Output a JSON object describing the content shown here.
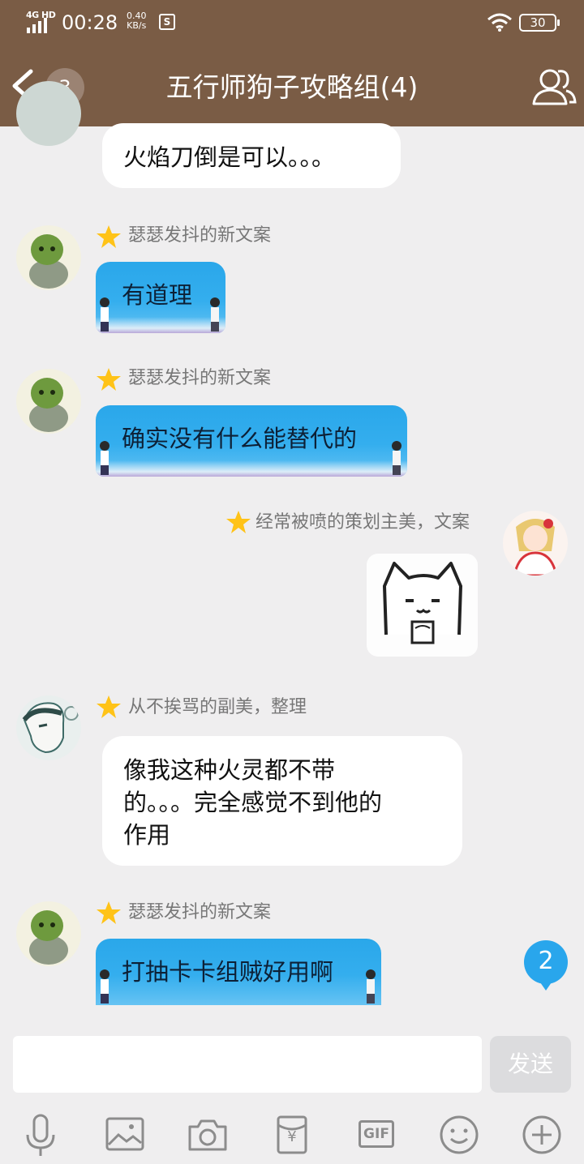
{
  "status_bar": {
    "network": "4G HD",
    "time": "00:28",
    "speed_value": "0.40",
    "speed_unit": "KB/s",
    "s_icon": "S",
    "battery": "30"
  },
  "header": {
    "unread_count": "3",
    "title": "五行师狗子攻略组(4)"
  },
  "messages": [
    {
      "text": "火焰刀倒是可以。。。"
    },
    {
      "sender": "瑟瑟发抖的新文案",
      "text": "有道理"
    },
    {
      "sender": "瑟瑟发抖的新文案",
      "text": "确实没有什么能替代的"
    },
    {
      "sender": "经常被喷的策划主美，文案"
    },
    {
      "sender": "从不挨骂的副美，整理",
      "lines": [
        "像我这种火灵都不带",
        "的。。。完全感觉不到他的",
        "作用"
      ]
    },
    {
      "sender": "瑟瑟发抖的新文案",
      "text": "打抽卡卡组贼好用啊"
    }
  ],
  "new_message_badge": "2",
  "input": {
    "value": "",
    "send_label": "发送"
  },
  "toolbar": {
    "items": [
      "mic-icon",
      "image-icon",
      "camera-icon",
      "red-packet-icon",
      "gif-icon",
      "emoji-icon",
      "plus-icon"
    ],
    "gif_label": "GIF",
    "red_packet_symbol": "¥"
  },
  "colors": {
    "header_bg": "#7a5c45",
    "chat_bg": "#efeeef",
    "bubble_blue": "#2aa7ea",
    "badge_blue": "#29a6ec"
  }
}
